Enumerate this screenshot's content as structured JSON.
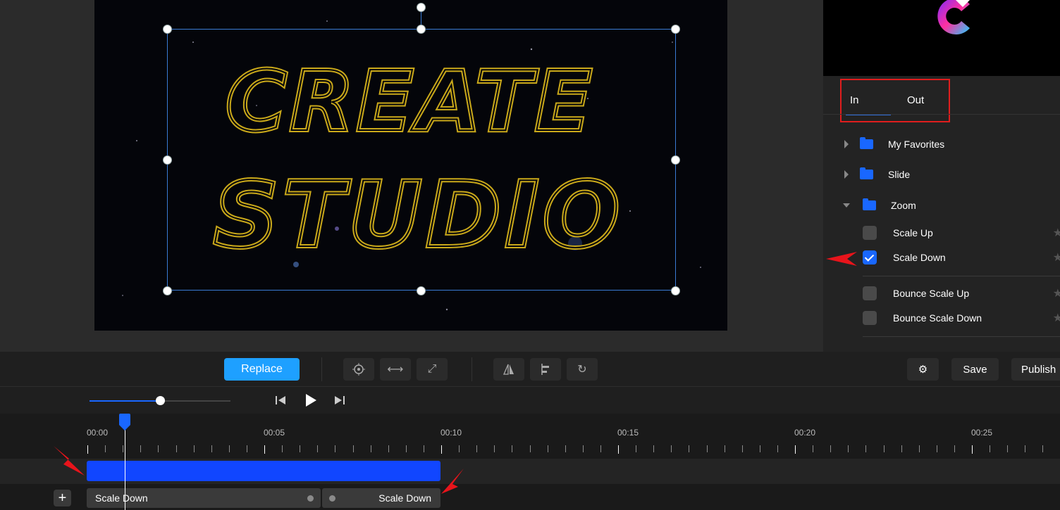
{
  "canvas": {
    "title_line1": "CREATE",
    "title_line2": "STUDIO"
  },
  "panel": {
    "tabs": [
      {
        "label": "In",
        "active": true
      },
      {
        "label": "Out",
        "active": false
      }
    ],
    "folders": [
      {
        "label": "My Favorites",
        "expanded": false
      },
      {
        "label": "Slide",
        "expanded": false
      },
      {
        "label": "Zoom",
        "expanded": true
      }
    ],
    "animations": [
      {
        "label": "Scale Up",
        "checked": false
      },
      {
        "label": "Scale Down",
        "checked": true
      },
      {
        "label": "Bounce Scale Up",
        "checked": false
      },
      {
        "label": "Bounce Scale Down",
        "checked": false
      }
    ]
  },
  "toolbar": {
    "replace_label": "Replace",
    "save_label": "Save",
    "publish_label": "Publish"
  },
  "timeline": {
    "ruler_labels": [
      "00:00",
      "00:05",
      "00:10",
      "00:15",
      "00:20",
      "00:25"
    ],
    "anim_in_label": "Scale Down",
    "anim_out_label": "Scale Down"
  },
  "colors": {
    "accent": "#1967ff",
    "replace": "#1ea0ff",
    "highlight": "#e01d1d",
    "title_gold": "#c9a81a"
  }
}
